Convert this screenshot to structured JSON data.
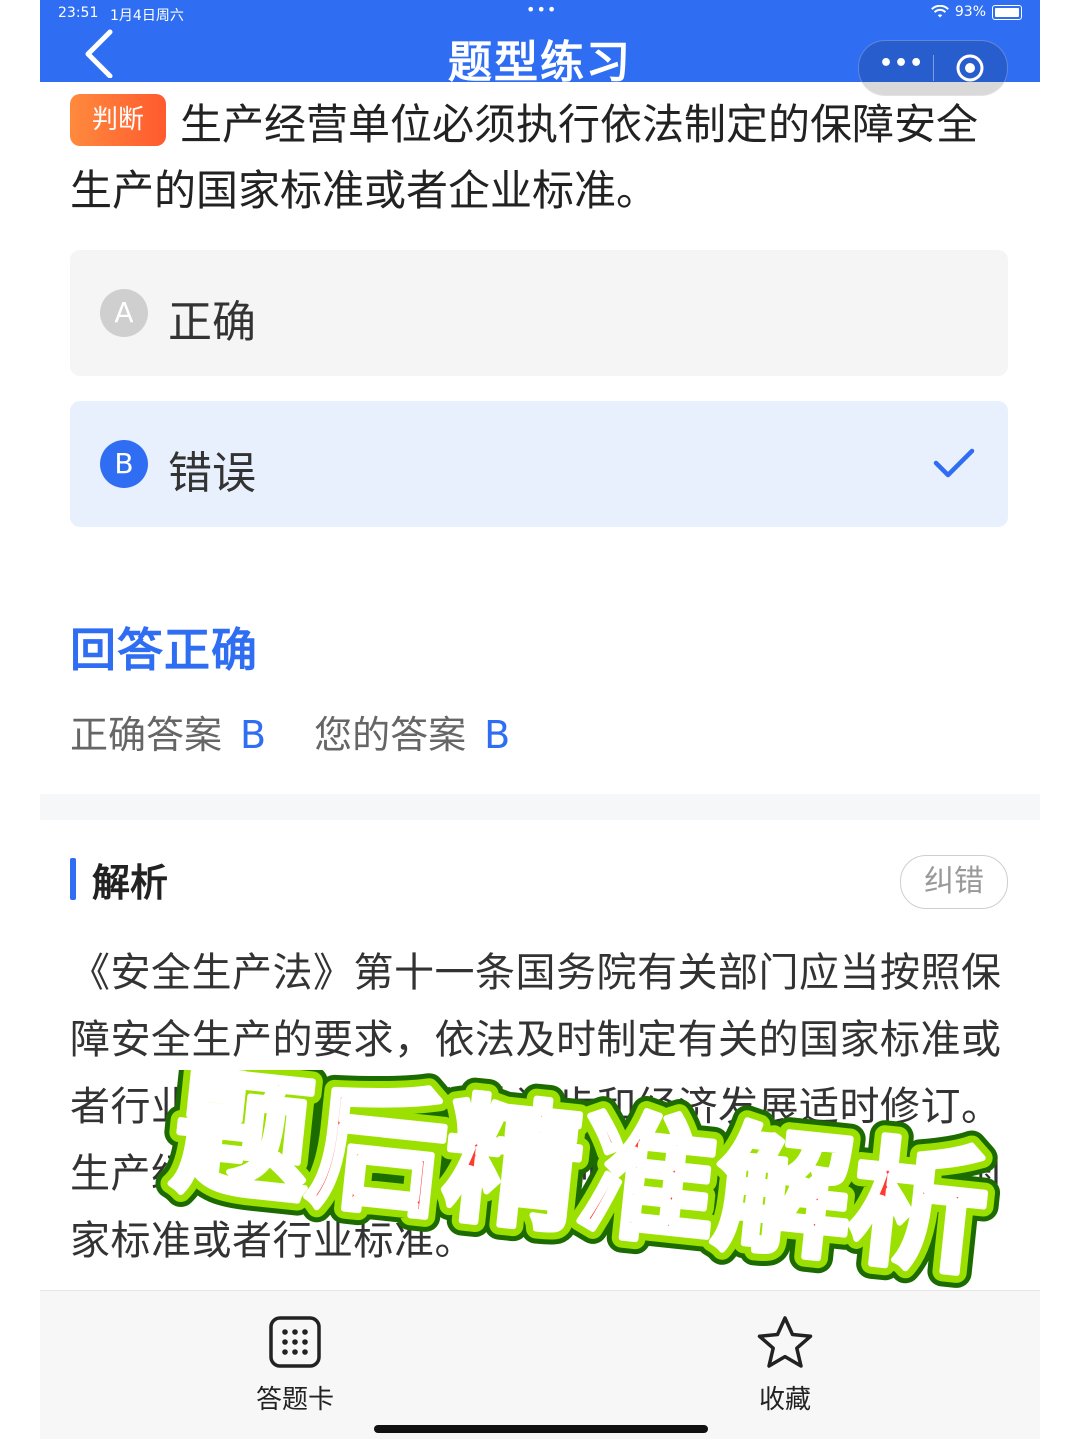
{
  "status_bar": {
    "time": "23:51",
    "date": "1月4日周六",
    "battery": "93%",
    "battery_level": 0.93
  },
  "header": {
    "title": "题型练习",
    "back_icon": "chevron-left-icon",
    "more_icon": "more-dots-icon",
    "target_icon": "target-icon"
  },
  "question": {
    "type_tag": "判断",
    "text": "生产经营单位必须执行依法制定的保障安全生产的国家标准或者企业标准。"
  },
  "options": [
    {
      "letter": "A",
      "label": "正确",
      "selected": false
    },
    {
      "letter": "B",
      "label": "错误",
      "selected": true
    }
  ],
  "result": {
    "title": "回答正确",
    "correct_label": "正确答案",
    "correct_value": "B",
    "your_label": "您的答案",
    "your_value": "B"
  },
  "analysis": {
    "title": "解析",
    "report_button": "纠错",
    "text": "《安全生产法》第十一条国务院有关部门应当按照保障安全生产的要求，依法及时制定有关的国家标准或者行业标准，并根据科技进步和经济发展适时修订。生产经营单位必须执行依法制定的保障安全生产的国家标准或者行业标准。"
  },
  "overlay": {
    "text": "题后精准解析"
  },
  "bottom_bar": {
    "card_label": "答题卡",
    "favorite_label": "收藏"
  },
  "colors": {
    "primary": "#2f6ef2",
    "tag": "#ff6a33",
    "overlay_fill": "#ff3b30",
    "overlay_outline": "#9be000"
  }
}
